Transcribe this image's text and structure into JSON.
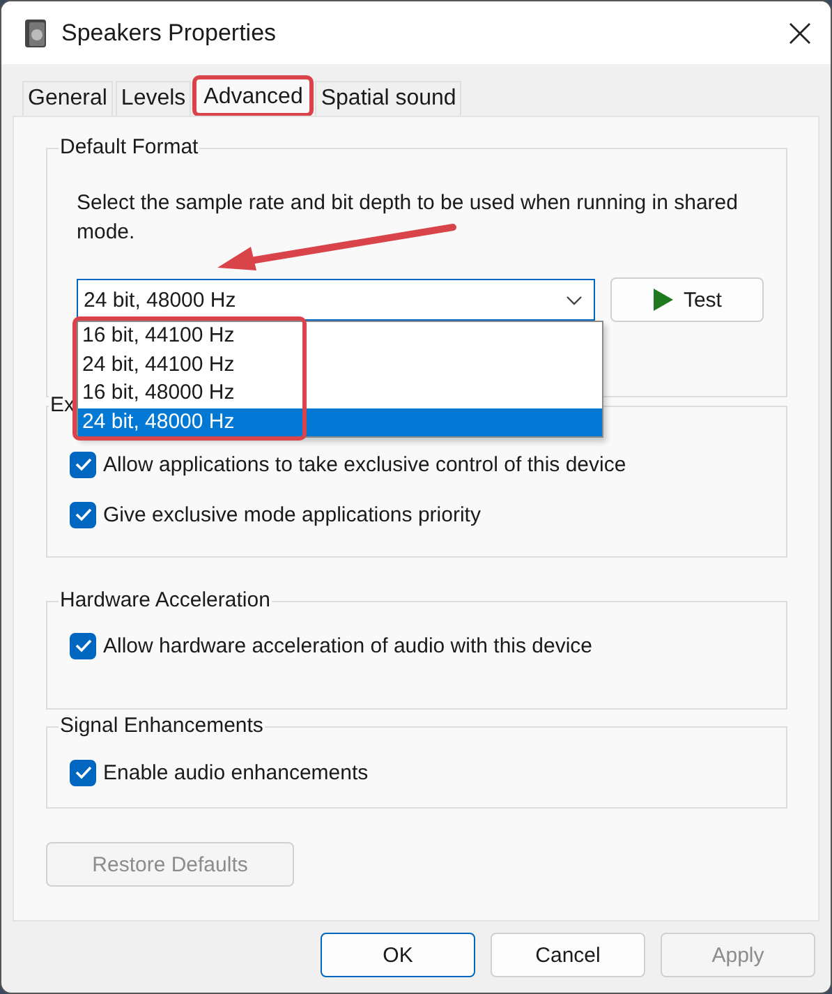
{
  "window": {
    "title": "Speakers Properties"
  },
  "tabs": [
    {
      "label": "General",
      "selected": false,
      "highlighted": false
    },
    {
      "label": "Levels",
      "selected": false,
      "highlighted": false
    },
    {
      "label": "Advanced",
      "selected": true,
      "highlighted": true
    },
    {
      "label": "Spatial sound",
      "selected": false,
      "highlighted": false
    }
  ],
  "default_format": {
    "title": "Default Format",
    "description": "Select the sample rate and bit depth to be used when running in shared mode.",
    "value": "24 bit, 48000 Hz",
    "arrow": true,
    "test_button": "Test",
    "options": {
      "highlighted": true,
      "items": [
        {
          "label": "16 bit, 44100 Hz",
          "selected": false
        },
        {
          "label": "24 bit, 44100 Hz",
          "selected": false
        },
        {
          "label": "16 bit, 48000 Hz",
          "selected": false
        },
        {
          "label": "24 bit, 48000 Hz",
          "selected": true
        }
      ]
    }
  },
  "groups": [
    {
      "title": "Ex",
      "options": [
        {
          "label": "Allow applications to take exclusive control of this device",
          "checked": true
        },
        {
          "label": "Give exclusive mode applications priority",
          "checked": true
        }
      ]
    },
    {
      "title": "Hardware Acceleration",
      "options": [
        {
          "label": "Allow hardware acceleration of audio with this device",
          "checked": true
        }
      ]
    },
    {
      "title": "Signal Enhancements",
      "options": [
        {
          "label": "Enable audio enhancements",
          "checked": true
        }
      ]
    }
  ],
  "restore_button": {
    "label": "Restore Defaults",
    "disabled": true
  },
  "buttons": [
    {
      "label": "OK",
      "disabled": false,
      "default": true
    },
    {
      "label": "Cancel",
      "disabled": false,
      "default": false
    },
    {
      "label": "Apply",
      "disabled": true,
      "default": false
    }
  ]
}
